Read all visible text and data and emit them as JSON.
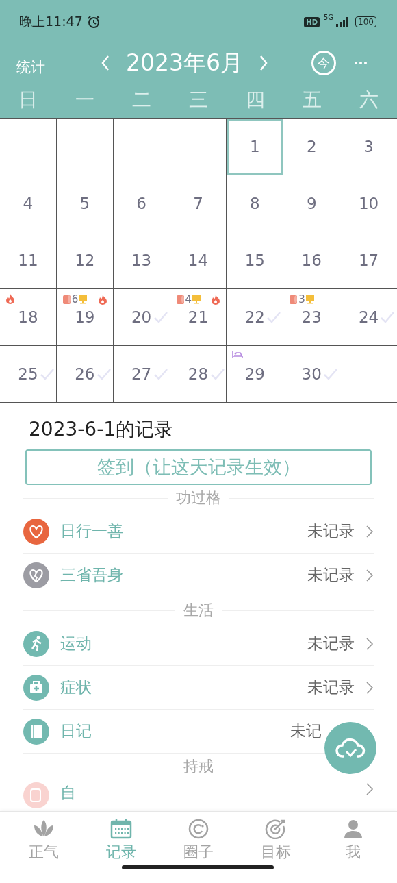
{
  "status_bar": {
    "time": "晚上11:47",
    "hd": "HD",
    "network": "5G",
    "battery": "100"
  },
  "header": {
    "left": "统计",
    "title": "2023年6月",
    "today": "今"
  },
  "weekdays": [
    "日",
    "一",
    "二",
    "三",
    "四",
    "五",
    "六"
  ],
  "weeks": [
    [
      {
        "kind": "empty"
      },
      {
        "kind": "empty"
      },
      {
        "kind": "empty"
      },
      {
        "kind": "empty"
      },
      {
        "kind": "day",
        "day": "1",
        "selected": true,
        "checked": false
      },
      {
        "kind": "day",
        "day": "2",
        "selected": false,
        "checked": false
      },
      {
        "kind": "day",
        "day": "3",
        "selected": false,
        "checked": false
      }
    ],
    [
      {
        "kind": "day",
        "day": "4",
        "selected": false,
        "checked": false
      },
      {
        "kind": "day",
        "day": "5",
        "selected": false,
        "checked": false
      },
      {
        "kind": "day",
        "day": "6",
        "selected": false,
        "checked": false
      },
      {
        "kind": "day",
        "day": "7",
        "selected": false,
        "checked": false
      },
      {
        "kind": "day",
        "day": "8",
        "selected": false,
        "checked": false
      },
      {
        "kind": "day",
        "day": "9",
        "selected": false,
        "checked": false
      },
      {
        "kind": "day",
        "day": "10",
        "selected": false,
        "checked": false
      }
    ],
    [
      {
        "kind": "day",
        "day": "11",
        "selected": false,
        "checked": false
      },
      {
        "kind": "day",
        "day": "12",
        "selected": false,
        "checked": false
      },
      {
        "kind": "day",
        "day": "13",
        "selected": false,
        "checked": false
      },
      {
        "kind": "day",
        "day": "14",
        "selected": false,
        "checked": false
      },
      {
        "kind": "day",
        "day": "15",
        "selected": false,
        "checked": false
      },
      {
        "kind": "day",
        "day": "16",
        "selected": false,
        "checked": false
      },
      {
        "kind": "day",
        "day": "17",
        "selected": false,
        "checked": false
      }
    ],
    [
      {
        "kind": "day",
        "day": "18",
        "selected": false,
        "checked": false,
        "marks": [
          {
            "kind": "fire"
          }
        ]
      },
      {
        "kind": "day",
        "day": "19",
        "selected": false,
        "checked": false,
        "marks": [
          {
            "kind": "roll",
            "count": "6"
          },
          {
            "kind": "screen"
          },
          {
            "kind": "fire"
          }
        ]
      },
      {
        "kind": "day",
        "day": "20",
        "selected": false,
        "checked": true
      },
      {
        "kind": "day",
        "day": "21",
        "selected": false,
        "checked": false,
        "marks": [
          {
            "kind": "roll",
            "count": "4"
          },
          {
            "kind": "screen"
          },
          {
            "kind": "fire"
          }
        ]
      },
      {
        "kind": "day",
        "day": "22",
        "selected": false,
        "checked": true
      },
      {
        "kind": "day",
        "day": "23",
        "selected": false,
        "checked": false,
        "marks": [
          {
            "kind": "roll",
            "count": "3"
          },
          {
            "kind": "screen"
          }
        ]
      },
      {
        "kind": "day",
        "day": "24",
        "selected": false,
        "checked": true
      }
    ],
    [
      {
        "kind": "day",
        "day": "25",
        "selected": false,
        "checked": true
      },
      {
        "kind": "day",
        "day": "26",
        "selected": false,
        "checked": true
      },
      {
        "kind": "day",
        "day": "27",
        "selected": false,
        "checked": true
      },
      {
        "kind": "day",
        "day": "28",
        "selected": false,
        "checked": true
      },
      {
        "kind": "day",
        "day": "29",
        "selected": false,
        "checked": false,
        "marks": [
          {
            "kind": "bed"
          }
        ]
      },
      {
        "kind": "day",
        "day": "30",
        "selected": false,
        "checked": true
      },
      {
        "kind": "empty"
      }
    ]
  ],
  "record": {
    "title": "2023-6-1的记录",
    "checkin_button": "签到（让这天记录生效）"
  },
  "sections": [
    {
      "title": "功过格",
      "items": [
        {
          "kind": "heart",
          "label": "日行一善",
          "status": "未记录",
          "chevron": true
        },
        {
          "kind": "broken-heart",
          "label": "三省吾身",
          "status": "未记录",
          "chevron": true
        }
      ]
    },
    {
      "title": "生活",
      "items": [
        {
          "kind": "runner",
          "label": "运动",
          "status": "未记录",
          "chevron": true
        },
        {
          "kind": "medkit",
          "label": "症状",
          "status": "未记录",
          "chevron": true
        },
        {
          "kind": "book",
          "label": "日记",
          "status": "未记",
          "chevron": false
        }
      ]
    },
    {
      "title": "持戒",
      "items": [
        {
          "kind": "roll",
          "label": "自",
          "chevron": true
        }
      ]
    }
  ],
  "tabs": [
    {
      "kind": "lotus",
      "label": "正气",
      "selected": false
    },
    {
      "kind": "calendar",
      "label": "记录",
      "selected": true
    },
    {
      "kind": "circle",
      "label": "圈子",
      "selected": false
    },
    {
      "kind": "target",
      "label": "目标",
      "selected": false
    },
    {
      "kind": "person",
      "label": "我",
      "selected": false
    }
  ]
}
